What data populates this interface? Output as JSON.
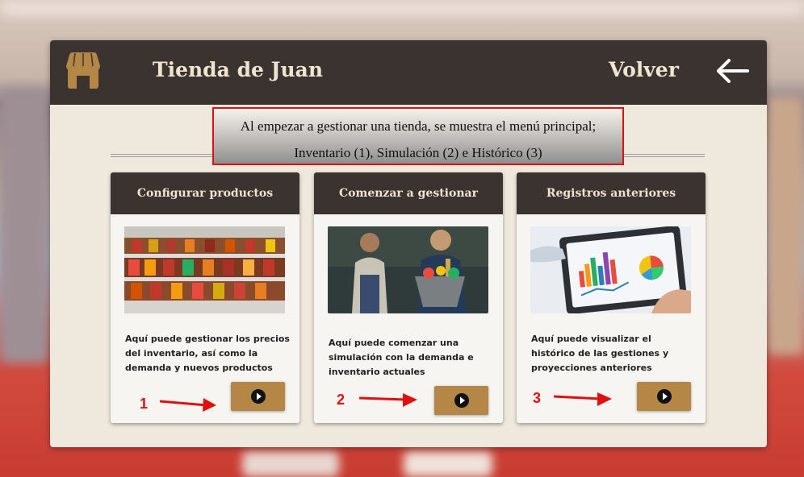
{
  "header": {
    "store_name": "Tienda de Juan",
    "back_label": "Volver",
    "icons": [
      "store-icon",
      "arrow-left-icon"
    ]
  },
  "callout": {
    "line1": "Al empezar a gestionar una tienda, se muestra el menú principal;",
    "line2": "Inventario (1), Simulación (2) e Histórico (3)"
  },
  "cards": [
    {
      "title": "Configurar productos",
      "description": "Aquí puede gestionar los precios del inventario, así como la demanda y nuevos productos",
      "step": "1",
      "image": "store-shelves-photo"
    },
    {
      "title": "Comenzar a gestionar",
      "description": "Aquí puede comenzar una simulación con la demanda e inventario actuales",
      "step": "2",
      "image": "shoppers-photo"
    },
    {
      "title": "Registros anteriores",
      "description": "Aquí puede visualizar el histórico de las gestiones y proyecciones anteriores",
      "step": "3",
      "image": "analytics-tablet-photo"
    }
  ],
  "colors": {
    "header_bg": "#3b3330",
    "panel_bg": "#efe8dc",
    "button": "#b48747",
    "annotation": "#e01010"
  }
}
